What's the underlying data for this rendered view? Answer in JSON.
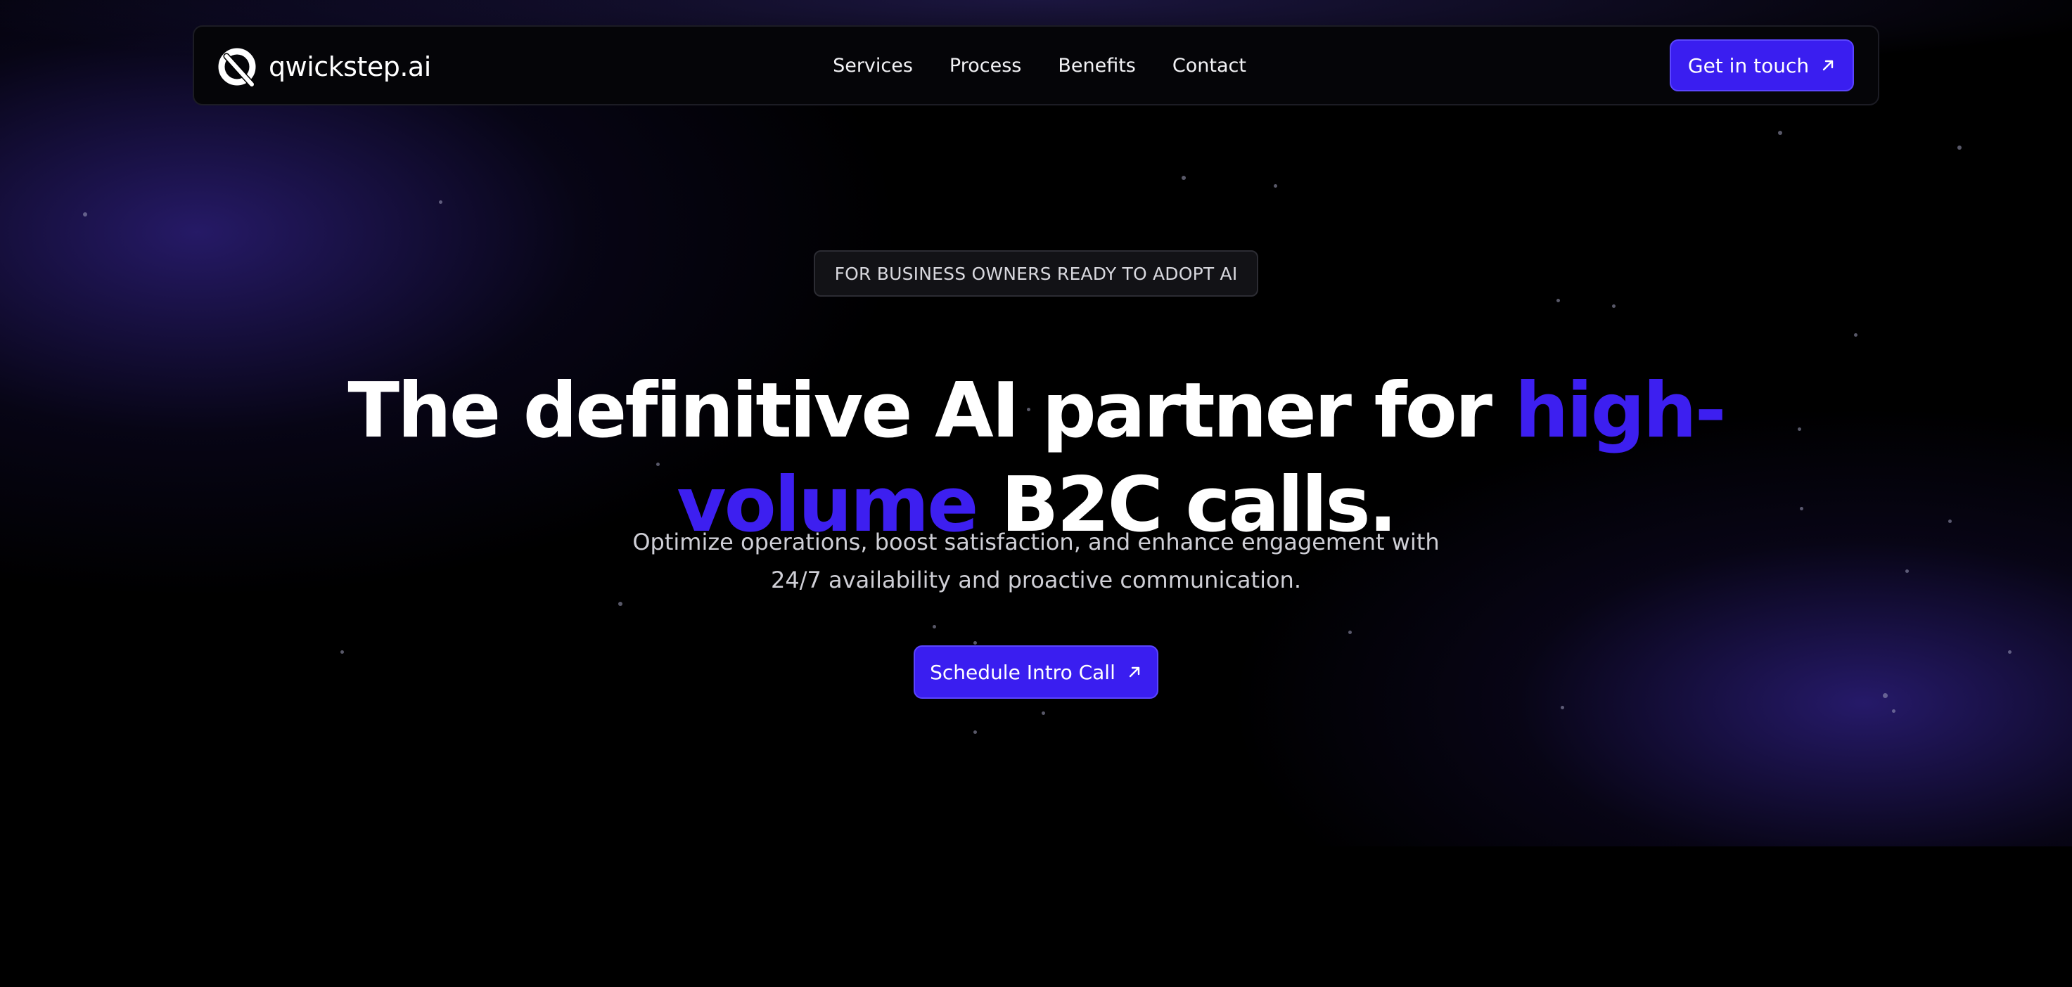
{
  "brand": {
    "name": "qwickstep.ai",
    "logo_icon": "qwickstep-logo-icon"
  },
  "nav": {
    "links": [
      "Services",
      "Process",
      "Benefits",
      "Contact"
    ],
    "cta_label": "Get in touch",
    "cta_icon": "arrow-up-right-icon"
  },
  "hero": {
    "badge": "FOR BUSINESS OWNERS READY TO ADOPT AI",
    "headline_part1": "The definitive AI partner for ",
    "headline_accent": "high-volume",
    "headline_part2": " B2C calls.",
    "subtitle_line1": "Optimize operations, boost satisfaction, and enhance engagement with",
    "subtitle_line2": "24/7 availability and proactive communication.",
    "button_label": "Schedule Intro Call",
    "button_icon": "arrow-up-right-icon"
  },
  "colors": {
    "accent": "#3a1ef0",
    "background": "#000000",
    "text": "#ffffff"
  }
}
